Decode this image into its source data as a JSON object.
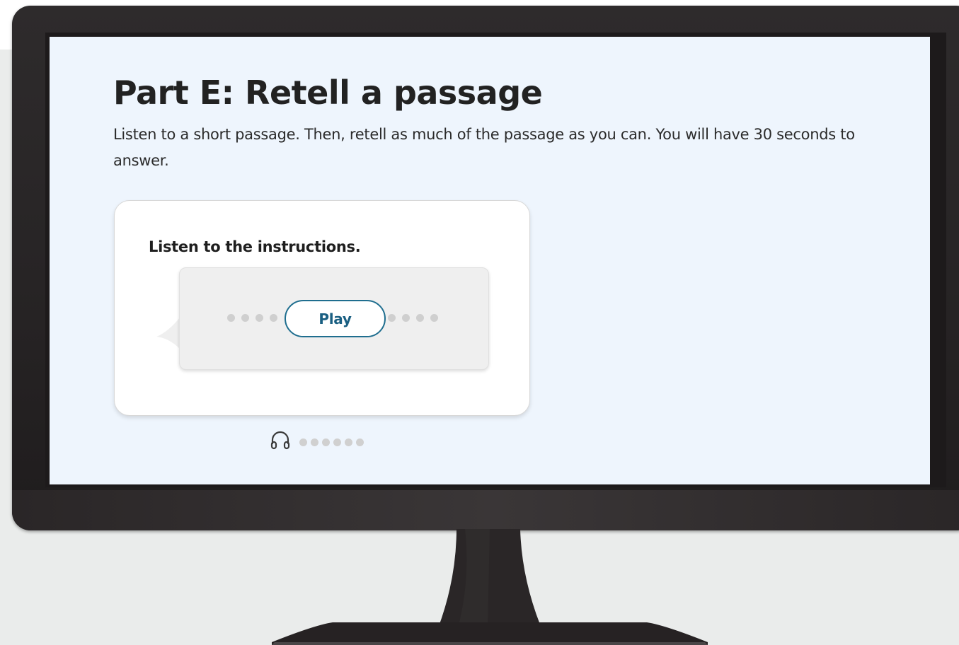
{
  "colors": {
    "screen_background": "#eef5fd",
    "monitor_frame": "#2a2627",
    "play_button_accent": "#1f6e8f",
    "dot_gray": "#cfcfcf"
  },
  "page": {
    "title": "Part E: Retell a passage",
    "instructions": "Listen to a short passage. Then, retell as much of the passage as you can. You will have 30 seconds to answer."
  },
  "card": {
    "label": "Listen to the instructions.",
    "play_button_label": "Play"
  },
  "audio_status": {
    "icon": "headphones-icon"
  }
}
